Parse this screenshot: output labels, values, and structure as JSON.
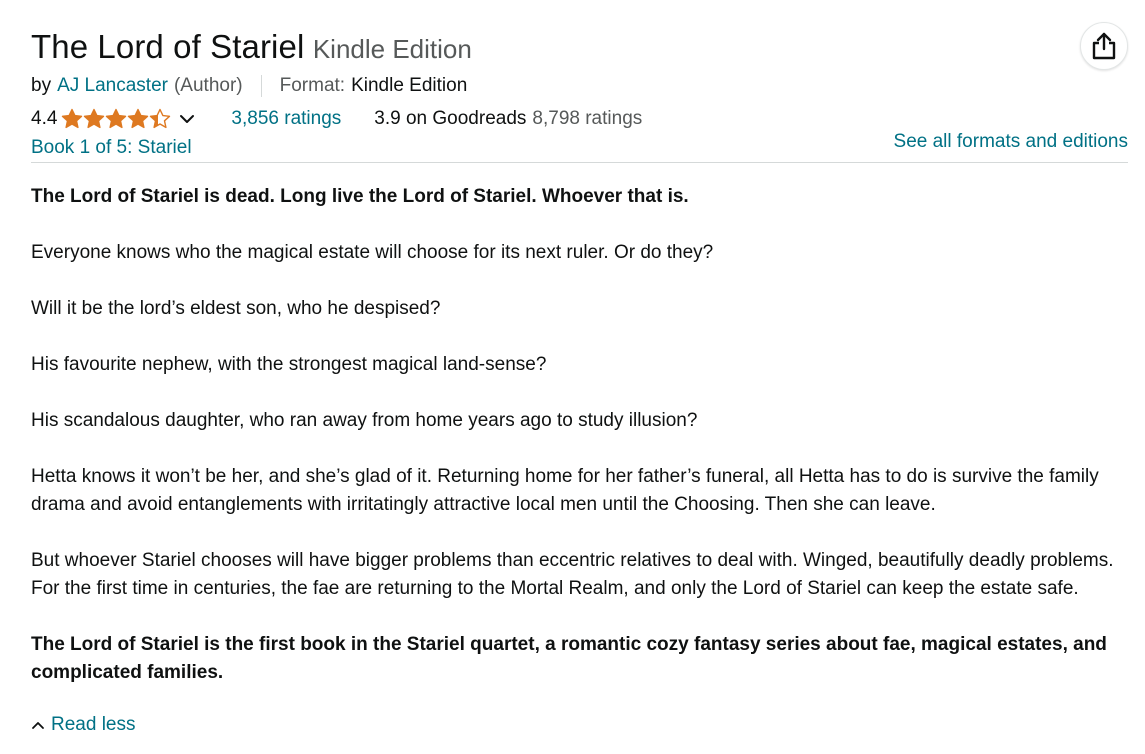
{
  "book": {
    "title": "The Lord of Stariel",
    "edition": "Kindle Edition"
  },
  "byline": {
    "prefix": "by",
    "author": "AJ Lancaster",
    "role": "(Author)",
    "format_label": "Format:",
    "format_value": "Kindle Edition"
  },
  "rating": {
    "score": "4.4",
    "stars_value": 4.4,
    "stars_max": 5,
    "star_color": "#de7921",
    "ratings_link": "3,856 ratings",
    "goodreads_score": "3.9 on Goodreads",
    "goodreads_ratings": "8,798 ratings"
  },
  "series": {
    "label": "Book 1 of 5: Stariel"
  },
  "formats_link": "See all formats and editions",
  "description": [
    {
      "text": "The Lord of Stariel is dead. Long live the Lord of Stariel. Whoever that is.",
      "bold": true
    },
    {
      "text": "Everyone knows who the magical estate will choose for its next ruler. Or do they?",
      "bold": false
    },
    {
      "text": "Will it be the lord’s eldest son, who he despised?",
      "bold": false
    },
    {
      "text": "His favourite nephew, with the strongest magical land-sense?",
      "bold": false
    },
    {
      "text": "His scandalous daughter, who ran away from home years ago to study illusion?",
      "bold": false
    },
    {
      "text": "Hetta knows it won’t be her, and she’s glad of it. Returning home for her father’s funeral, all Hetta has to do is survive the family drama and avoid entanglements with irritatingly attractive local men until the Choosing. Then she can leave.",
      "bold": false
    },
    {
      "text": "But whoever Stariel chooses will have bigger problems than eccentric relatives to deal with. Winged, beautifully deadly problems. For the first time in centuries, the fae are returning to the Mortal Realm, and only the Lord of Stariel can keep the estate safe.",
      "bold": false
    },
    {
      "text": "The Lord of Stariel is the first book in the Stariel quartet, a romantic cozy fantasy series about fae, magical estates, and complicated families.",
      "bold": true
    }
  ],
  "read_less": "Read less",
  "icons": {
    "share": "share-icon",
    "chevron": "chevron-down-icon",
    "read_less": "chevron-up-icon"
  },
  "colors": {
    "link": "#007185",
    "muted": "#565959",
    "text": "#0f1111"
  }
}
